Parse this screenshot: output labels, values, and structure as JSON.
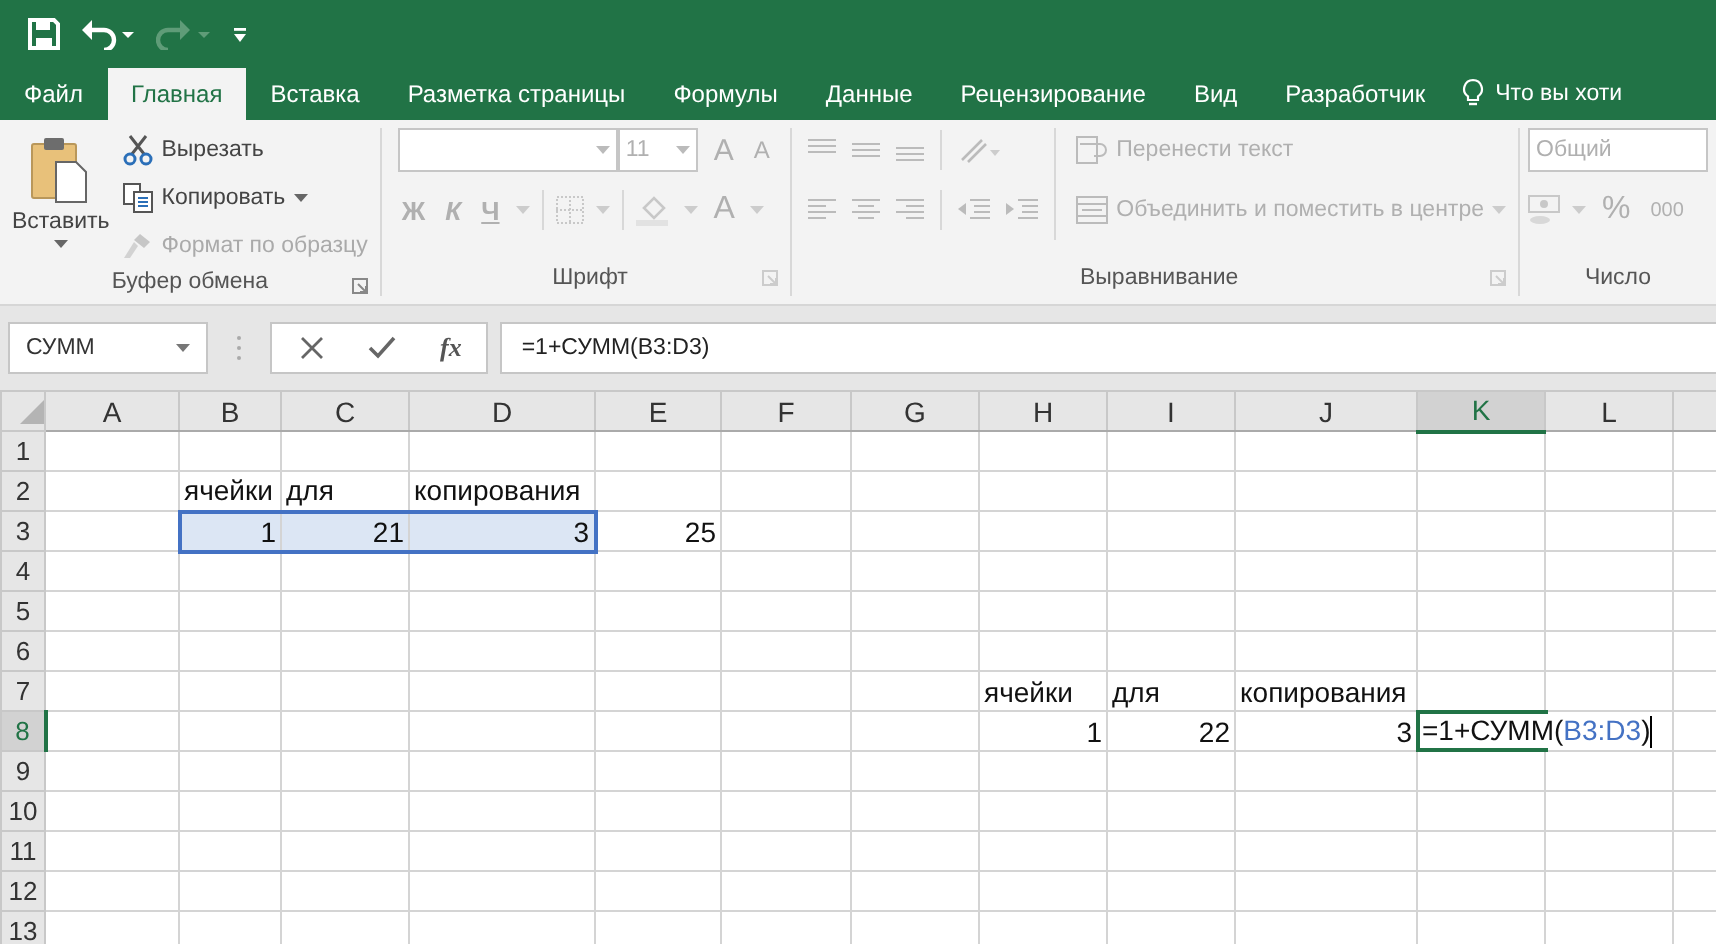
{
  "quick_access": [
    {
      "kind": "save",
      "disabled": false
    },
    {
      "kind": "undo",
      "disabled": false
    },
    {
      "kind": "redo",
      "disabled": true
    },
    {
      "kind": "customize",
      "disabled": false
    }
  ],
  "tabs": [
    {
      "label": "Файл",
      "selected": false
    },
    {
      "label": "Главная",
      "selected": true
    },
    {
      "label": "Вставка",
      "selected": false
    },
    {
      "label": "Разметка страницы",
      "selected": false
    },
    {
      "label": "Формулы",
      "selected": false
    },
    {
      "label": "Данные",
      "selected": false
    },
    {
      "label": "Рецензирование",
      "selected": false
    },
    {
      "label": "Вид",
      "selected": false
    },
    {
      "label": "Разработчик",
      "selected": false
    }
  ],
  "tell_me": "Что вы хоти",
  "clipboard": {
    "title": "Буфер обмена",
    "paste": "Вставить",
    "items": [
      {
        "kind": "cut",
        "label": "Вырезать",
        "disabled": false
      },
      {
        "kind": "copy",
        "label": "Копировать",
        "disabled": false
      },
      {
        "kind": "painter",
        "label": "Формат по образцу",
        "disabled": true
      }
    ]
  },
  "font": {
    "title": "Шрифт",
    "disabled": true,
    "font_size": "11",
    "size_buttons": [
      {
        "kind": "grow",
        "label": "A"
      },
      {
        "kind": "shrink",
        "label": "A"
      }
    ],
    "style_buttons": [
      {
        "kind": "bold",
        "label": "Ж"
      },
      {
        "kind": "italic",
        "label": "К"
      },
      {
        "kind": "underline",
        "label": "Ч"
      }
    ],
    "color_button": "A"
  },
  "alignment": {
    "title": "Выравнивание",
    "disabled": true,
    "wrap": "Перенести текст",
    "merge": "Объединить и поместить в центре"
  },
  "number": {
    "title": "Число",
    "disabled": true,
    "format": "Общий",
    "percent": "%",
    "thousands": "000"
  },
  "formula_bar": {
    "name_box": "СУММ",
    "function_button": "fx",
    "formula": "=1+СУММ(B3:D3)"
  },
  "columns": [
    {
      "label": "A",
      "selected": false
    },
    {
      "label": "B",
      "selected": false
    },
    {
      "label": "C",
      "selected": false
    },
    {
      "label": "D",
      "selected": false
    },
    {
      "label": "E",
      "selected": false
    },
    {
      "label": "F",
      "selected": false
    },
    {
      "label": "G",
      "selected": false
    },
    {
      "label": "H",
      "selected": false
    },
    {
      "label": "I",
      "selected": false
    },
    {
      "label": "J",
      "selected": false
    },
    {
      "label": "K",
      "selected": true
    },
    {
      "label": "L",
      "selected": false
    }
  ],
  "rows": [
    {
      "number": "1",
      "selected": false,
      "cells": [
        {},
        {},
        {},
        {},
        {},
        {},
        {},
        {},
        {},
        {},
        {},
        {}
      ]
    },
    {
      "number": "2",
      "selected": false,
      "cells": [
        {},
        {
          "kind": "text",
          "value": "ячейки",
          "referenced": false
        },
        {
          "kind": "text",
          "value": "для",
          "referenced": false
        },
        {
          "kind": "text",
          "value": "копирования",
          "referenced": false
        },
        {},
        {},
        {},
        {},
        {},
        {},
        {},
        {}
      ]
    },
    {
      "number": "3",
      "selected": false,
      "cells": [
        {},
        {
          "kind": "number",
          "value": "1",
          "referenced": true
        },
        {
          "kind": "number",
          "value": "21",
          "referenced": true
        },
        {
          "kind": "number",
          "value": "3",
          "referenced": true
        },
        {
          "kind": "number",
          "value": "25",
          "referenced": false
        },
        {},
        {},
        {},
        {},
        {},
        {},
        {}
      ]
    },
    {
      "number": "4",
      "selected": false,
      "cells": [
        {},
        {},
        {},
        {},
        {},
        {},
        {},
        {},
        {},
        {},
        {},
        {}
      ]
    },
    {
      "number": "5",
      "selected": false,
      "cells": [
        {},
        {},
        {},
        {},
        {},
        {},
        {},
        {},
        {},
        {},
        {},
        {}
      ]
    },
    {
      "number": "6",
      "selected": false,
      "cells": [
        {},
        {},
        {},
        {},
        {},
        {},
        {},
        {},
        {},
        {},
        {},
        {}
      ]
    },
    {
      "number": "7",
      "selected": false,
      "cells": [
        {},
        {},
        {},
        {},
        {},
        {},
        {},
        {
          "kind": "text",
          "value": "ячейки",
          "referenced": false
        },
        {
          "kind": "text",
          "value": "для",
          "referenced": false
        },
        {
          "kind": "text",
          "value": "копирования",
          "referenced": false
        },
        {},
        {}
      ]
    },
    {
      "number": "8",
      "selected": true,
      "cells": [
        {},
        {},
        {},
        {},
        {},
        {},
        {},
        {
          "kind": "number",
          "value": "1",
          "referenced": false
        },
        {
          "kind": "number",
          "value": "22",
          "referenced": false
        },
        {
          "kind": "number",
          "value": "3",
          "referenced": false
        },
        {
          "kind": "editing",
          "value": "=1+СУММ(",
          "reference": "B3:D3",
          "suffix": ")"
        },
        {}
      ]
    },
    {
      "number": "9",
      "selected": false,
      "cells": [
        {},
        {},
        {},
        {},
        {},
        {},
        {},
        {},
        {},
        {},
        {},
        {}
      ]
    },
    {
      "number": "10",
      "selected": false,
      "cells": [
        {},
        {},
        {},
        {},
        {},
        {},
        {},
        {},
        {},
        {},
        {},
        {}
      ]
    },
    {
      "number": "11",
      "selected": false,
      "cells": [
        {},
        {},
        {},
        {},
        {},
        {},
        {},
        {},
        {},
        {},
        {},
        {}
      ]
    },
    {
      "number": "12",
      "selected": false,
      "cells": [
        {},
        {},
        {},
        {},
        {},
        {},
        {},
        {},
        {},
        {},
        {},
        {}
      ]
    },
    {
      "number": "13",
      "selected": false,
      "cells": [
        {},
        {},
        {},
        {},
        {},
        {},
        {},
        {},
        {},
        {},
        {},
        {}
      ]
    }
  ]
}
